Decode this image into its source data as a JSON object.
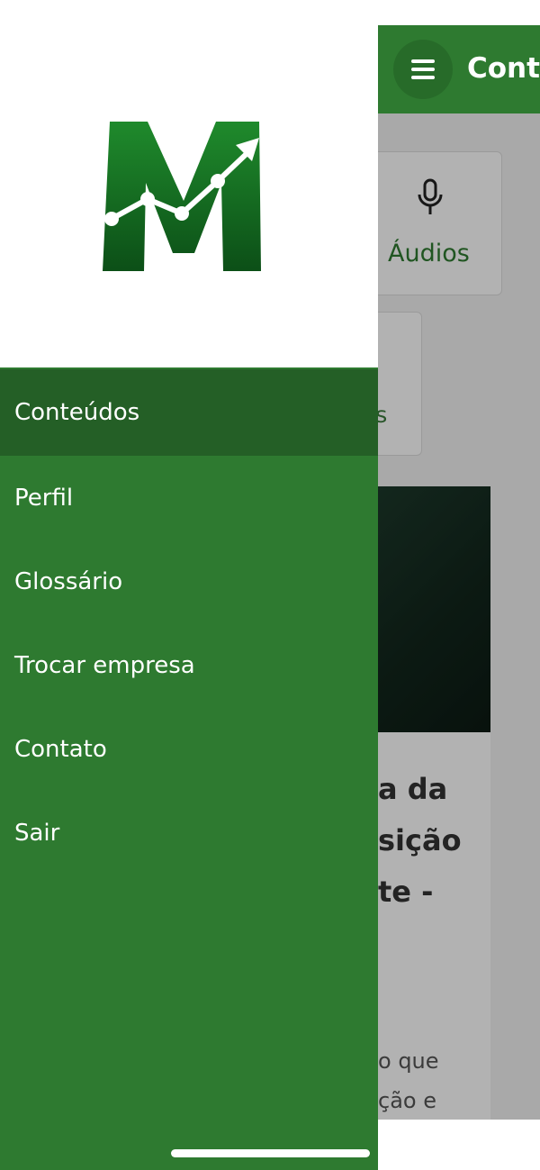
{
  "header": {
    "title": "Conte"
  },
  "content": {
    "audio_card_label": "Áudios",
    "video_card_label": "os",
    "article": {
      "title_lines": [
        "a da",
        "sição",
        "te -"
      ],
      "excerpt_lines": [
        "o que",
        "ção e"
      ]
    }
  },
  "drawer": {
    "logo_letter": "M",
    "items": [
      {
        "label": "Conteúdos",
        "active": true
      },
      {
        "label": "Perfil"
      },
      {
        "label": "Glossário"
      },
      {
        "label": "Trocar empresa"
      },
      {
        "label": "Contato"
      },
      {
        "label": "Sair"
      }
    ]
  },
  "icons": {
    "menu": "hamburger-icon",
    "audio": "microphone-icon",
    "logo": "logo-m-chart-icon"
  },
  "colors": {
    "primary_green": "#2e7a30",
    "active_item_green": "#245f26",
    "logo_dark_green": "#0f5a1b"
  }
}
